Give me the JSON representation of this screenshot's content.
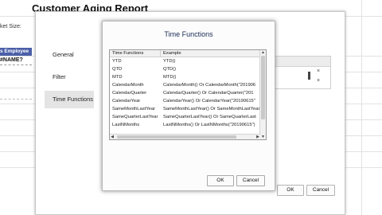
{
  "background": {
    "report_title": "Customer Aging Report",
    "sheet_label": "ket Size:",
    "column_header": "s Employee",
    "error_cell": "#NAME?"
  },
  "back_dialog": {
    "nav": [
      {
        "label": "General",
        "active": false
      },
      {
        "label": "Filter",
        "active": false
      },
      {
        "label": "Time Functions",
        "active": true
      }
    ],
    "ok_label": "OK",
    "cancel_label": "Cancel",
    "remove_glyph": "×"
  },
  "time_functions_dialog": {
    "title": "Time Functions",
    "columns": [
      "Time Functions",
      "Example"
    ],
    "rows": [
      {
        "name": "YTD",
        "example": "YTD()"
      },
      {
        "name": "QTD",
        "example": "QTD()"
      },
      {
        "name": "MTD",
        "example": "MTD()"
      },
      {
        "name": "CalendarMonth",
        "example": "CalendarMonth() Or CalendarMonth(\"201906"
      },
      {
        "name": "CalendarQuarter",
        "example": "CalendarQuarter() Or CalendarQuarter(\"201"
      },
      {
        "name": "CalendarYear",
        "example": "CalendarYear() Or CalendarYear(\"20190615\""
      },
      {
        "name": "SameMonthLastYear",
        "example": "SameMonthLastYear() Or SameMonthLastYear"
      },
      {
        "name": "SameQuarterLastYear",
        "example": "SameQuarterLastYear() Or SameQuarterLast"
      },
      {
        "name": "LastNMonths",
        "example": "LastNMonths() Or LastNMonths(\"20190615\")"
      }
    ],
    "ok_label": "OK",
    "cancel_label": "Cancel"
  },
  "colors": {
    "header_blue": "#4a5fa8",
    "title_navy": "#1a2c55",
    "nav_active": "#e4e4e4"
  }
}
